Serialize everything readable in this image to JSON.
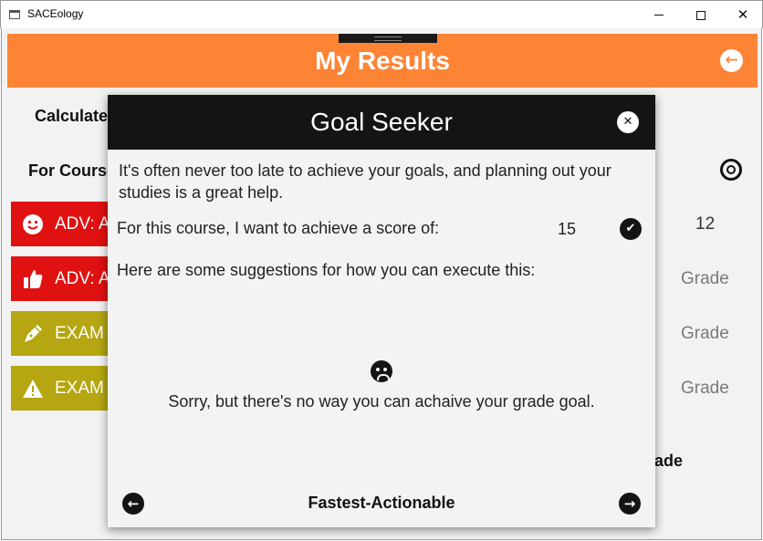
{
  "window": {
    "title": "SACEology"
  },
  "header": {
    "title": "My Results"
  },
  "background": {
    "calculate_label": "Calculate",
    "course_label": "For Course",
    "grade_label": "rade",
    "rows": [
      {
        "icon": "smile-icon",
        "label": "ADV: A",
        "value": "12",
        "color": "#e01111"
      },
      {
        "icon": "thumbs-up-icon",
        "label": "ADV: A",
        "value": "Grade",
        "color": "#e01111"
      },
      {
        "icon": "pen-icon",
        "label": "EXAM",
        "value": "Grade",
        "color": "#b5a612"
      },
      {
        "icon": "warning-icon",
        "label": "EXAM",
        "value": "Grade",
        "color": "#b5a612"
      }
    ]
  },
  "modal": {
    "title": "Goal Seeker",
    "intro": "It's often never too late to achieve your goals, and planning out your studies is a great help.",
    "goal_label": "For this course, I want to achieve a score of:",
    "goal_value": "15",
    "suggest_label": "Here are some suggestions for how you can execute this:",
    "result_message": "Sorry, but there's no way you can achaive your grade goal.",
    "strategy": "Fastest-Actionable"
  },
  "colors": {
    "accent": "#fd8435",
    "modal_header": "#141414",
    "red": "#e01111",
    "olive": "#b5a612"
  }
}
